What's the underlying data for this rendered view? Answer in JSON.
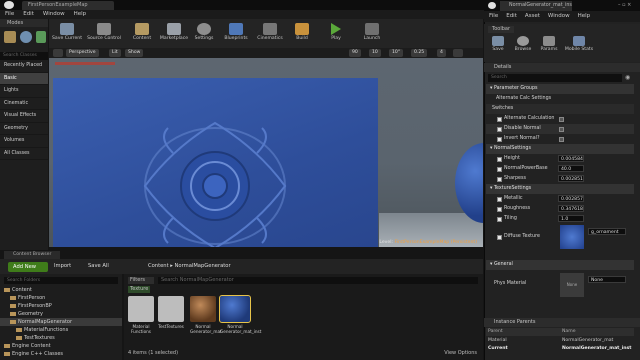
{
  "editor": {
    "tab": "FirstPersonExampleMap",
    "menu": [
      "File",
      "Edit",
      "Window",
      "Help"
    ]
  },
  "modes": {
    "tab": "Modes",
    "search_placeholder": "Search Classes",
    "items": [
      "Recently Placed",
      "Basic",
      "Lights",
      "Cinematic",
      "Visual Effects",
      "Geometry",
      "Volumes",
      "All Classes"
    ],
    "selected": "Basic"
  },
  "toolbar": {
    "buttons": [
      "Save Current",
      "Source Control",
      "Content",
      "Marketplace",
      "Settings",
      "Blueprints",
      "Cinematics",
      "Build",
      "Play",
      "Launch"
    ]
  },
  "viewport": {
    "perspective": "Perspective",
    "lit": "Lit",
    "show": "Show",
    "fov": "90",
    "snap": "10",
    "rot": "10°",
    "scale": "0.25",
    "speed": "4",
    "level_label": "Level:",
    "level_name": "FirstPersonExampleMap (Persistent)"
  },
  "content_browser": {
    "tab": "Content Browser",
    "add_new": "Add New",
    "import": "Import",
    "save_all": "Save All",
    "path": [
      "Content",
      "NormalMapGenerator"
    ],
    "search_folders_placeholder": "Search Folders",
    "filters": "Filters",
    "search_assets_placeholder": "Search NormalMapGenerator",
    "texture_chip": "Texture",
    "tree": [
      {
        "label": "Content",
        "depth": 0
      },
      {
        "label": "FirstPerson",
        "depth": 1
      },
      {
        "label": "FirstPersonBP",
        "depth": 1
      },
      {
        "label": "Geometry",
        "depth": 1
      },
      {
        "label": "NormalMapGenerator",
        "depth": 1
      },
      {
        "label": "MaterialFunctions",
        "depth": 2
      },
      {
        "label": "TestTextures",
        "depth": 2
      },
      {
        "label": "Engine Content",
        "depth": 0
      },
      {
        "label": "Engine C++ Classes",
        "depth": 0
      }
    ],
    "assets": [
      {
        "name": "Material Functions",
        "kind": "folder"
      },
      {
        "name": "TestTextures",
        "kind": "folder"
      },
      {
        "name": "Normal Generator_mat",
        "kind": "material"
      },
      {
        "name": "Normal Generator_mat_inst",
        "kind": "instance"
      }
    ],
    "status": "4 items (1 selected)",
    "view_options": "View Options"
  },
  "material_editor": {
    "tab": "NormalGenerator_mat_inst",
    "menu": [
      "File",
      "Edit",
      "Asset",
      "Window",
      "Help"
    ],
    "toolbar_tab": "Toolbar",
    "toolbar_buttons": [
      "Save",
      "Browse",
      "Params",
      "Mobile Stats"
    ],
    "details_tab": "Details",
    "search_placeholder": "Search",
    "parameter_groups": "Parameter Groups",
    "alternate_calc": "Alternate Calc Settings",
    "switches": "Switches",
    "switch_rows": [
      "Alternate Calculation",
      "Disable Normal",
      "Invert Normal?"
    ],
    "normal_settings": "NormalSettings",
    "normal_rows": [
      {
        "name": "Height",
        "value": "0.004584"
      },
      {
        "name": "NormalPowerBase",
        "value": "40.0"
      },
      {
        "name": "Sharpess",
        "value": "0.002851"
      }
    ],
    "texture_settings": "TextureSettings",
    "texture_rows": [
      {
        "name": "Metallic",
        "value": "0.002857"
      },
      {
        "name": "Roughness",
        "value": "0.347618"
      },
      {
        "name": "Tiling",
        "value": "1.0"
      }
    ],
    "diffuse_texture": "Diffuse Texture",
    "diffuse_value": "g_ornament",
    "general": "General",
    "phys_material": "Phys Material",
    "phys_value": "None",
    "phys_thumb": "None",
    "instance_parents_tab": "Instance Parents",
    "ip_header": [
      "Parent",
      "Name"
    ],
    "ip_rows": [
      {
        "role": "Material",
        "name": "NormalGenerator_mat"
      },
      {
        "role": "Current",
        "name": "NormalGenerator_mat_inst"
      }
    ]
  }
}
